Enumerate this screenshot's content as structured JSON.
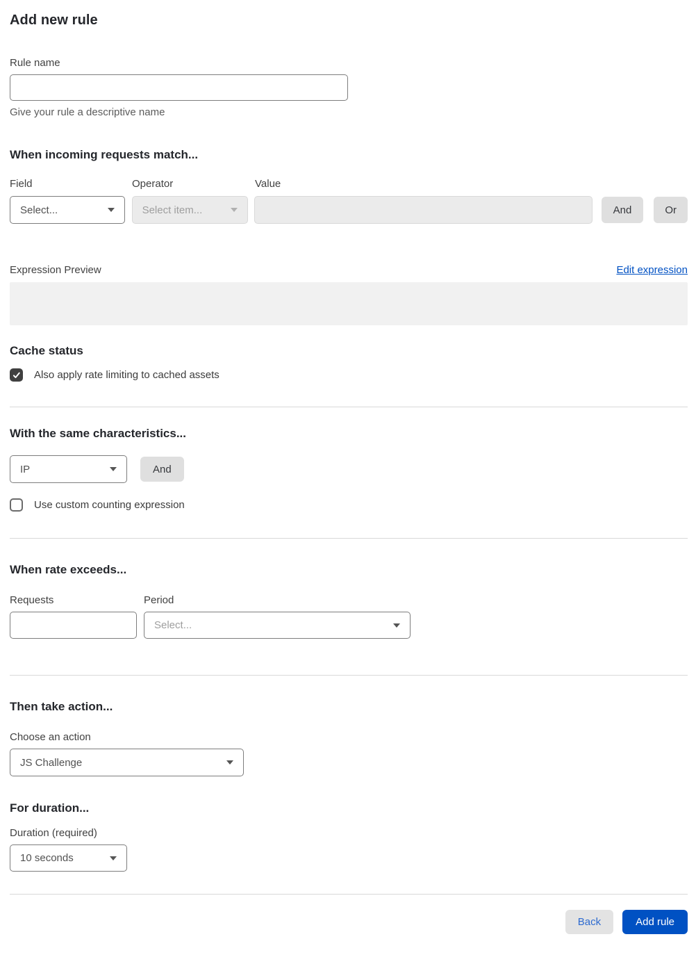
{
  "page": {
    "title": "Add new rule"
  },
  "rule_name": {
    "label": "Rule name",
    "value": "",
    "helper": "Give your rule a descriptive name"
  },
  "match_section": {
    "heading": "When incoming requests match...",
    "field": {
      "label": "Field",
      "selected": "Select..."
    },
    "operator": {
      "label": "Operator",
      "selected": "Select item...",
      "state": "disabled"
    },
    "value": {
      "label": "Value",
      "value": "",
      "state": "disabled"
    },
    "and_button": "And",
    "or_button": "Or",
    "expression_preview_label": "Expression Preview",
    "edit_expression_link": "Edit expression",
    "expression_preview_value": ""
  },
  "cache_section": {
    "heading": "Cache status",
    "checkbox_label": "Also apply rate limiting to cached assets",
    "checked": "true"
  },
  "characteristics_section": {
    "heading": "With the same characteristics...",
    "characteristic_selected": "IP",
    "and_button": "And",
    "custom_counting_label": "Use custom counting expression",
    "custom_counting_checked": "false"
  },
  "rate_section": {
    "heading": "When rate exceeds...",
    "requests": {
      "label": "Requests",
      "value": ""
    },
    "period": {
      "label": "Period",
      "selected": "Select..."
    }
  },
  "action_section": {
    "heading": "Then take action...",
    "choose_label": "Choose an action",
    "selected": "JS Challenge"
  },
  "duration_section": {
    "heading": "For duration...",
    "label": "Duration (required)",
    "selected": "10 seconds"
  },
  "footer": {
    "back_button": "Back",
    "add_rule_button": "Add rule"
  },
  "colors": {
    "accent_blue": "#0051c3",
    "back_button_text": "#2e6bd0",
    "checked_checkbox": "#404040",
    "disabled_bg": "#ebebeb",
    "preview_bg": "#f1f1f1",
    "gray_button_bg": "#dfdfdf"
  }
}
